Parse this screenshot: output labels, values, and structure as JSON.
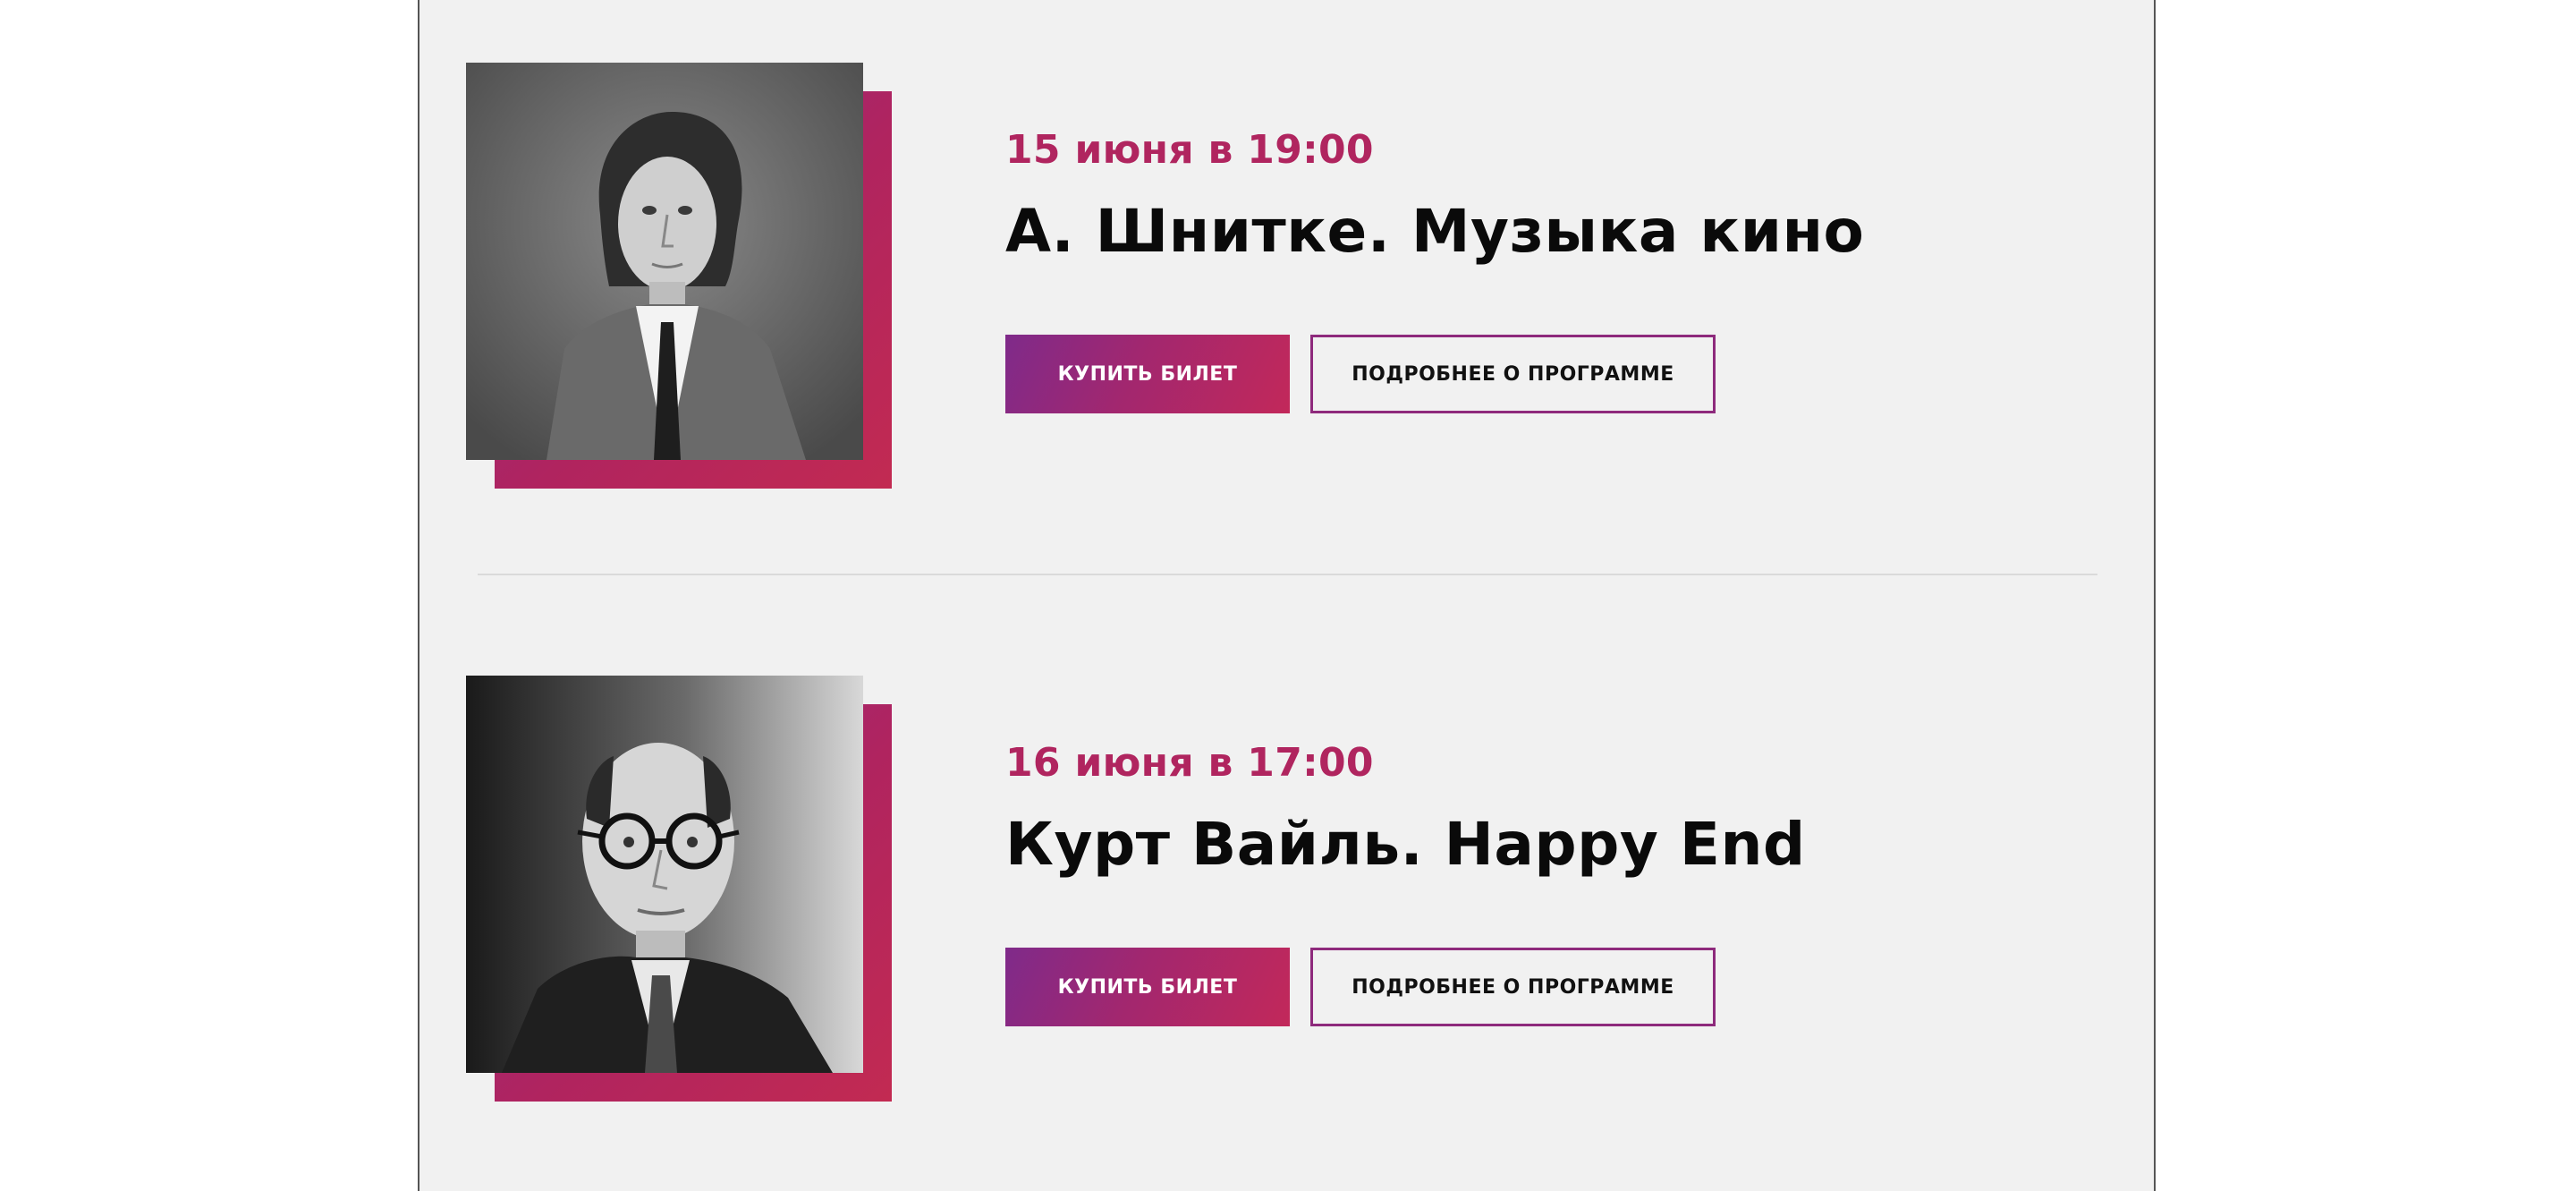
{
  "events": [
    {
      "date": "15 июня в 19:00",
      "title": "А. Шнитке. Музыка кино",
      "buy_label": "КУПИТЬ БИЛЕТ",
      "more_label": "ПОДРОБНЕЕ О ПРОГРАММЕ"
    },
    {
      "date": "16 июня в 17:00",
      "title": "Курт Вайль. Happy End",
      "buy_label": "КУПИТЬ БИЛЕТ",
      "more_label": "ПОДРОБНЕЕ О ПРОГРАММЕ"
    }
  ],
  "colors": {
    "accent": "#b0255f",
    "accent_purple": "#8e2a86",
    "background": "#f1f1f1",
    "text": "#0a0a0a"
  }
}
